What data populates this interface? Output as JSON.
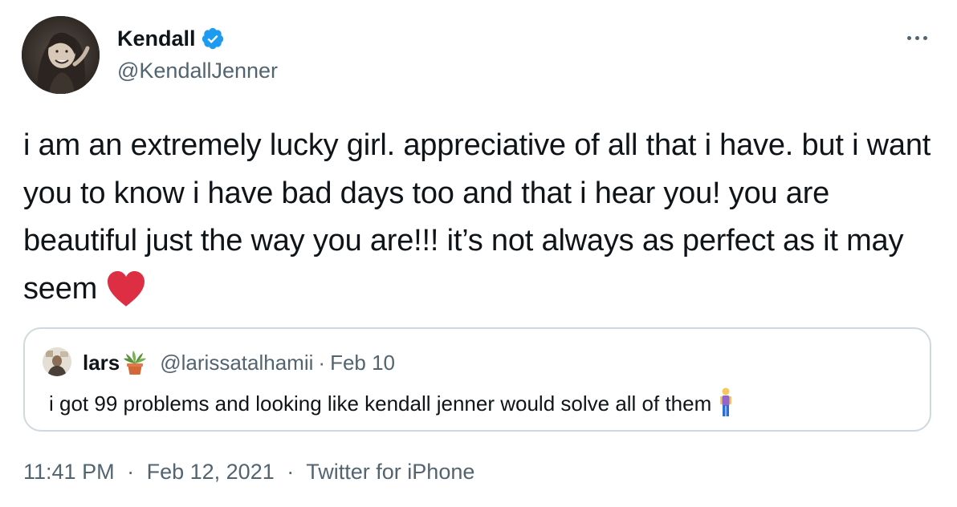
{
  "author": {
    "display_name": "Kendall",
    "handle": "@KendallJenner",
    "verified_icon": "verified-badge-icon",
    "avatar_icon": "profile-photo"
  },
  "header": {
    "more_icon": "more-options-icon"
  },
  "tweet": {
    "text": "i am an extremely lucky girl. appreciative of all that i have. but i want you to know i have bad days too and that i hear you! you are beautiful just the way you are!!! it’s not always as perfect as it may seem",
    "emoji": "red-heart-icon"
  },
  "quoted_tweet": {
    "display_name": "lars",
    "name_emoji": "potted-plant-icon",
    "handle": "@larissatalhamii",
    "separator": "·",
    "date": "Feb 10",
    "text": "i got 99 problems and looking like kendall jenner would solve all of them",
    "text_emoji": "person-standing-icon"
  },
  "meta": {
    "time": "11:41 PM",
    "separator": "·",
    "date": "Feb 12, 2021",
    "source": "Twitter for iPhone"
  },
  "colors": {
    "verified_blue": "#1d9bf0",
    "secondary_text": "#536471",
    "border": "#cfd9de",
    "heart_red": "#dd2e44"
  }
}
